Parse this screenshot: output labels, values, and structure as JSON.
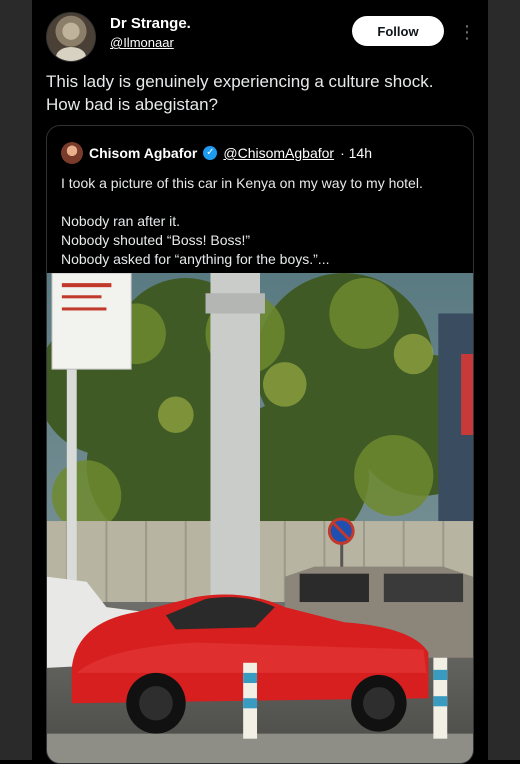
{
  "post": {
    "author_name": "Dr Strange.",
    "author_handle": "@Ilmonaar",
    "follow_label": "Follow",
    "more_icon": "more-vertical-icon",
    "text_lines": [
      "This lady is genuinely experiencing a culture shock.",
      "How bad is abegistan?"
    ]
  },
  "quote": {
    "author_name": "Chisom Agbafor",
    "verified_icon": "verified-badge-icon",
    "author_handle": "@ChisomAgbafor",
    "time": "· 14h",
    "lines": [
      "I took a picture of this car in Kenya on my way to my hotel.",
      "",
      "Nobody ran after it.",
      "Nobody shouted “Boss! Boss!”",
      "Nobody asked for “anything for the boys.”..."
    ]
  },
  "colors": {
    "background": "#000000",
    "text": "#e7e9ea",
    "border": "#2f3336",
    "verified": "#1d9bf0",
    "car_red": "#d71f1f"
  }
}
